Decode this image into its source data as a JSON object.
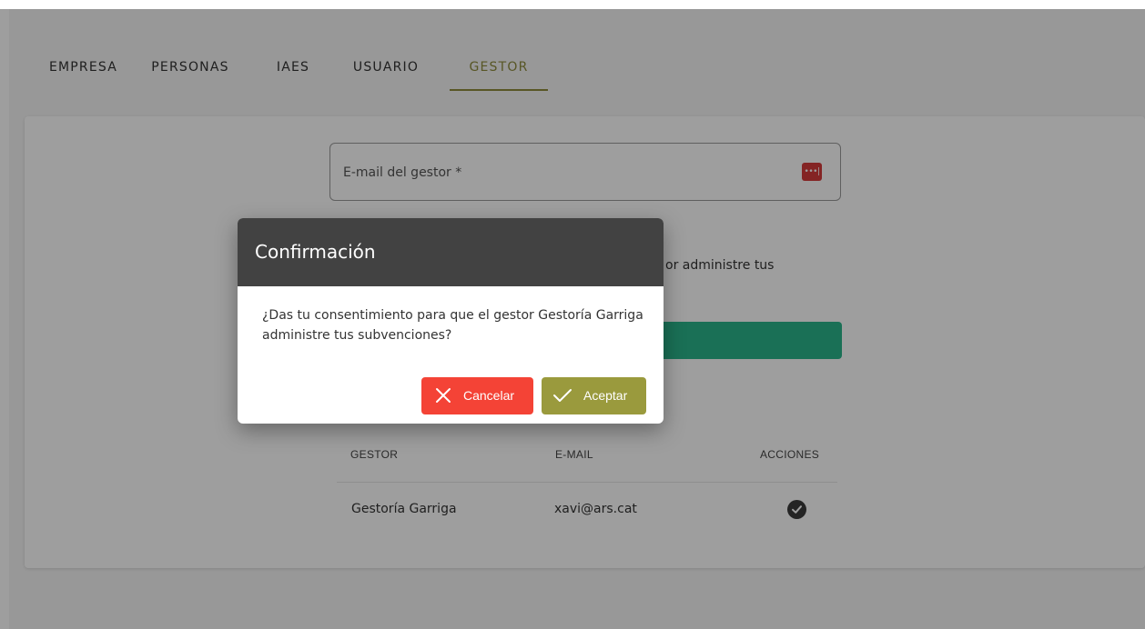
{
  "tabs": [
    {
      "label": "EMPRESA",
      "active": false
    },
    {
      "label": "PERSONAS",
      "active": false
    },
    {
      "label": "IAES",
      "active": false
    },
    {
      "label": "USUARIO",
      "active": false
    },
    {
      "label": "GESTOR",
      "active": true
    }
  ],
  "form": {
    "email_placeholder": "E-mail del gestor *",
    "password_manager_icon": "password-manager-icon",
    "partial_text": "or administre tus"
  },
  "table": {
    "headers": [
      "GESTOR",
      "E-MAIL",
      "ACCIONES"
    ],
    "rows": [
      {
        "gestor": "Gestoría Garriga",
        "email": "xavi@ars.cat",
        "action_icon": "check-circle-icon"
      }
    ]
  },
  "dialog": {
    "title": "Confirmación",
    "message": "¿Das tu consentimiento para que el gestor Gestoría Garriga administre tus subvenciones?",
    "cancel_label": "Cancelar",
    "accept_label": "Aceptar"
  },
  "colors": {
    "accent": "#8e8b3d",
    "cancel": "#f44336",
    "accept": "#9a9a3d",
    "green_button": "#2bb58c",
    "dialog_header": "#424242"
  }
}
